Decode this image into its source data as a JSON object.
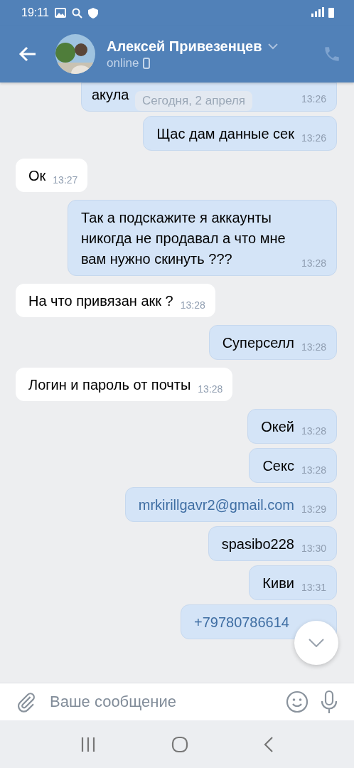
{
  "status_bar": {
    "time": "19:11"
  },
  "header": {
    "name": "Алексей Привезенцев",
    "status": "online"
  },
  "date_label": "Сегодня, 2 апреля",
  "messages": [
    {
      "outgoing": true,
      "kind": "text",
      "text": "акула",
      "time": "13:26"
    },
    {
      "outgoing": true,
      "kind": "text",
      "text": "Щас дам данные сек",
      "time": "13:26"
    },
    {
      "outgoing": false,
      "kind": "text",
      "text": "Ок",
      "time": "13:27"
    },
    {
      "outgoing": true,
      "kind": "text",
      "text": "Так а подскажите я аккаунты никогда не продавал а что мне вам нужно скинуть ???",
      "time": "13:28"
    },
    {
      "outgoing": false,
      "kind": "text",
      "text": "На что привязан акк ?",
      "time": "13:28"
    },
    {
      "outgoing": true,
      "kind": "text",
      "text": "Суперселл",
      "time": "13:28"
    },
    {
      "outgoing": false,
      "kind": "text",
      "text": "Логин и пароль от почты",
      "time": "13:28"
    },
    {
      "outgoing": true,
      "kind": "text",
      "text": "Окей",
      "time": "13:28"
    },
    {
      "outgoing": true,
      "kind": "text",
      "text": "Секс",
      "time": "13:28"
    },
    {
      "outgoing": true,
      "kind": "link",
      "text": "mrkirillgavr2@gmail.com",
      "time": "13:29"
    },
    {
      "outgoing": true,
      "kind": "text",
      "text": "spasibo228",
      "time": "13:30"
    },
    {
      "outgoing": true,
      "kind": "text",
      "text": "Киви",
      "time": "13:31"
    },
    {
      "outgoing": true,
      "kind": "link",
      "text": "+79780786614"
    }
  ],
  "composer": {
    "placeholder": "Ваше сообщение"
  }
}
